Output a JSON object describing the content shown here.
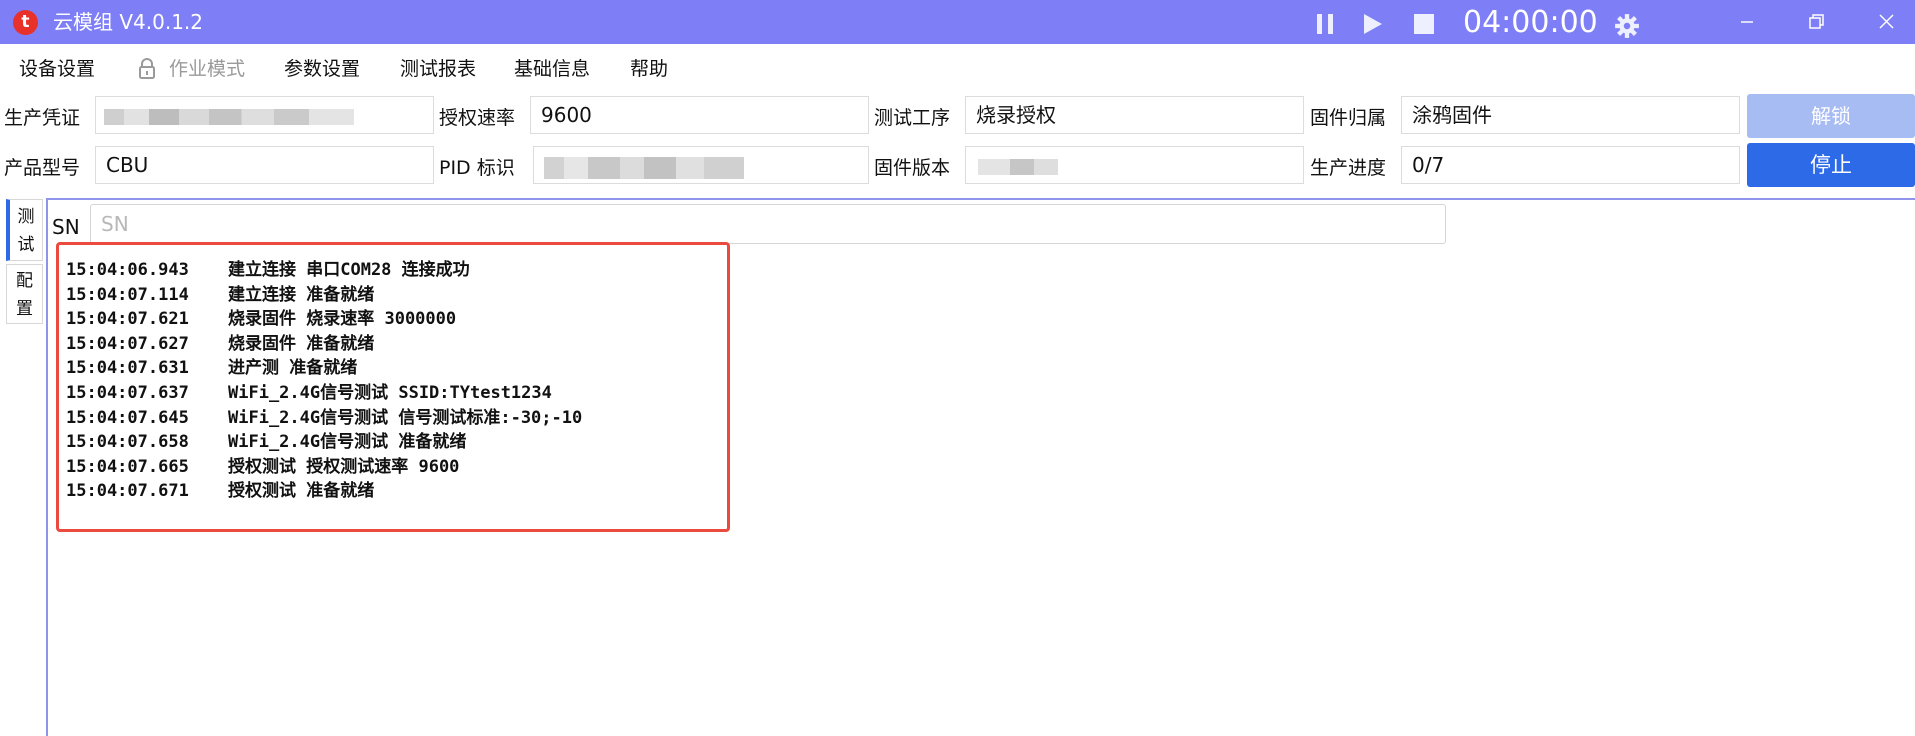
{
  "titlebar": {
    "logo_letter": "t",
    "title": "云模组 V4.0.1.2",
    "timer": "04:00:00",
    "icons": [
      "pause-icon",
      "play-icon",
      "stop-icon",
      "gear-icon",
      "minimize-icon",
      "restore-icon",
      "close-icon"
    ]
  },
  "menu": {
    "device_settings": "设备设置",
    "work_mode": "作业模式",
    "param_settings": "参数设置",
    "test_report": "测试报表",
    "basic_info": "基础信息",
    "help": "帮助"
  },
  "info": {
    "credential_label": "生产凭证",
    "credential_value": "",
    "auth_rate_label": "授权速率",
    "auth_rate_value": "9600",
    "process_label": "测试工序",
    "process_value": "烧录授权",
    "firmware_owner_label": "固件归属",
    "firmware_owner_value": "涂鸦固件",
    "model_label": "产品型号",
    "model_value": "CBU",
    "pid_label": "PID 标识",
    "pid_value": "",
    "firmware_version_label": "固件版本",
    "firmware_version_value": "",
    "progress_label": "生产进度",
    "progress_value": "0/7"
  },
  "buttons": {
    "unlock": "解锁",
    "stop": "停止"
  },
  "side_tabs": [
    {
      "label": "测试",
      "active": true
    },
    {
      "label": "配置",
      "active": false
    }
  ],
  "sn": {
    "label": "SN",
    "placeholder": "SN",
    "value": ""
  },
  "log": [
    {
      "time": "15:04:06.943",
      "text": "建立连接 串口COM28 连接成功"
    },
    {
      "time": "15:04:07.114",
      "text": "建立连接 准备就绪"
    },
    {
      "time": "15:04:07.621",
      "text": "烧录固件 烧录速率 3000000"
    },
    {
      "time": "15:04:07.627",
      "text": "烧录固件 准备就绪"
    },
    {
      "time": "15:04:07.631",
      "text": "进产测 准备就绪"
    },
    {
      "time": "15:04:07.637",
      "text": "WiFi_2.4G信号测试 SSID:TYtest1234"
    },
    {
      "time": "15:04:07.645",
      "text": "WiFi_2.4G信号测试 信号测试标准:-30;-10"
    },
    {
      "time": "15:04:07.658",
      "text": "WiFi_2.4G信号测试 准备就绪"
    },
    {
      "time": "15:04:07.665",
      "text": "授权测试 授权测试速率 9600"
    },
    {
      "time": "15:04:07.671",
      "text": "授权测试 准备就绪"
    }
  ],
  "colors": {
    "titlebar": "#7e7ef6",
    "accent": "#2d6ae8",
    "unlock_disabled": "#a8bcf4",
    "highlight_border": "#ea4b3e",
    "logo": "#e8312b"
  }
}
